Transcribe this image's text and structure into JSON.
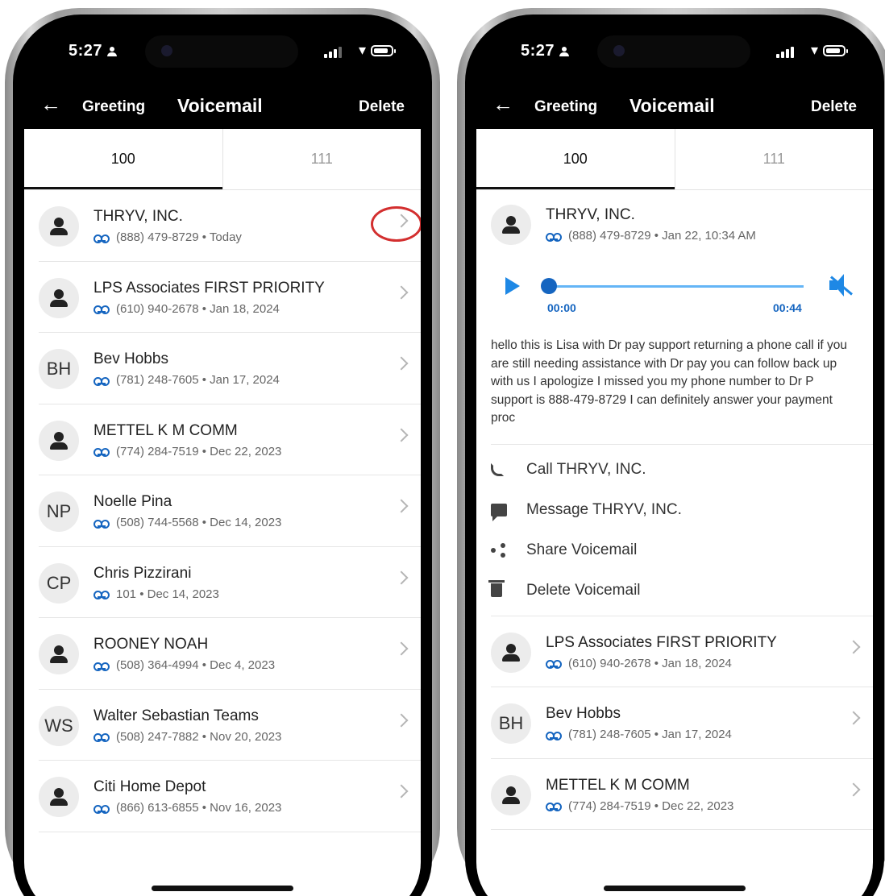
{
  "status": {
    "time": "5:27"
  },
  "nav": {
    "back_icon": "arrow-left-icon",
    "greeting": "Greeting",
    "title": "Voicemail",
    "delete": "Delete"
  },
  "tabs": [
    {
      "label": "100",
      "active": true
    },
    {
      "label": "111",
      "active": false
    }
  ],
  "list": [
    {
      "name": "THRYV, INC.",
      "avatar": "",
      "detail": "(888) 479-8729 • Today"
    },
    {
      "name": "LPS Associates FIRST PRIORITY",
      "avatar": "",
      "detail": "(610) 940-2678 • Jan 18, 2024"
    },
    {
      "name": "Bev Hobbs",
      "avatar": "BH",
      "detail": "(781) 248-7605 • Jan 17, 2024"
    },
    {
      "name": "METTEL K M COMM",
      "avatar": "",
      "detail": "(774) 284-7519 • Dec 22, 2023"
    },
    {
      "name": "Noelle Pina",
      "avatar": "NP",
      "detail": "(508) 744-5568 • Dec 14, 2023"
    },
    {
      "name": "Chris Pizzirani",
      "avatar": "CP",
      "detail": "101 • Dec 14, 2023"
    },
    {
      "name": "ROONEY NOAH",
      "avatar": "",
      "detail": "(508) 364-4994 • Dec 4, 2023"
    },
    {
      "name": "Walter Sebastian Teams",
      "avatar": "WS",
      "detail": "(508) 247-7882 • Nov 20, 2023"
    },
    {
      "name": "Citi Home Depot",
      "avatar": "",
      "detail": "(866) 613-6855 • Nov 16, 2023"
    }
  ],
  "expanded": {
    "name": "THRYV, INC.",
    "detail": "(888) 479-8729 • Jan 22, 10:34 AM",
    "player": {
      "current": "00:00",
      "duration": "00:44",
      "progress": 0,
      "muted": true
    },
    "transcript": "hello this is Lisa with Dr pay support returning a phone call if you are still needing assistance with Dr pay you can follow back up with us I apologize I missed you my phone number to Dr P support is 888-479-8729 I can definitely answer your payment proc",
    "actions": [
      {
        "label": "Call THRYV, INC.",
        "icon": "phone-icon"
      },
      {
        "label": "Message THRYV, INC.",
        "icon": "message-icon"
      },
      {
        "label": "Share Voicemail",
        "icon": "share-icon"
      },
      {
        "label": "Delete Voicemail",
        "icon": "trash-icon"
      }
    ]
  },
  "list_after": [
    {
      "name": "LPS Associates FIRST PRIORITY",
      "avatar": "",
      "detail": "(610) 940-2678 • Jan 18, 2024"
    },
    {
      "name": "Bev Hobbs",
      "avatar": "BH",
      "detail": "(781) 248-7605 • Jan 17, 2024"
    },
    {
      "name": "METTEL K M COMM",
      "avatar": "",
      "detail": "(774) 284-7519 • Dec 22, 2023"
    }
  ],
  "colors": {
    "accent": "#1565c0",
    "highlight_ring": "#d32f2f"
  }
}
